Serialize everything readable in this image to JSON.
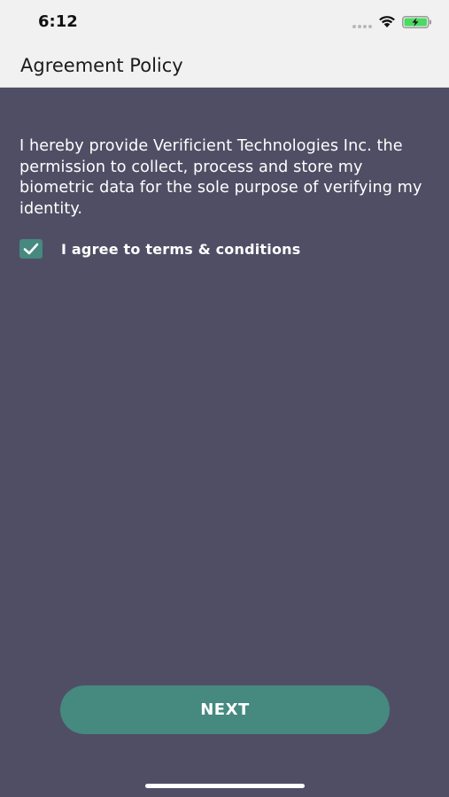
{
  "status_bar": {
    "time": "6:12",
    "icons": [
      "signal-dots-icon",
      "wifi-icon",
      "battery-charging-icon"
    ]
  },
  "nav": {
    "title": "Agreement Policy"
  },
  "policy": {
    "text": "I hereby provide Verificient Technologies Inc. the permission to collect, process and store my biometric data for the sole purpose of verifying my identity."
  },
  "agreement": {
    "label": "I agree to terms & conditions",
    "checked": true
  },
  "actions": {
    "next_label": "NEXT"
  },
  "colors": {
    "background": "#504e65",
    "accent": "#45897f",
    "header": "#f1f1f1",
    "battery_fill": "#4cd964"
  }
}
